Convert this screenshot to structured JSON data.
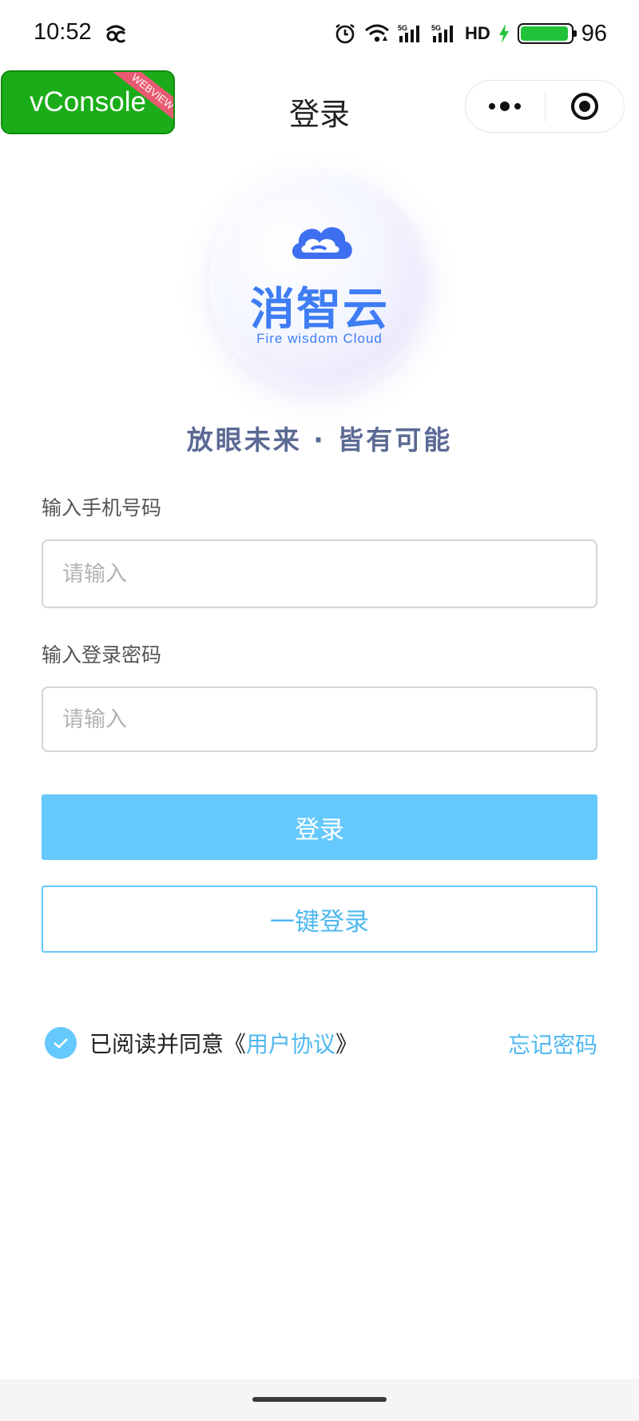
{
  "status_bar": {
    "time": "10:52",
    "left_icon": "app-notification-icon",
    "hd_label": "HD",
    "battery_percent": "96",
    "battery_level": 0.96,
    "icons": [
      "alarm-icon",
      "wifi-icon",
      "signal-5g-icon",
      "signal-5g-icon",
      "charging-icon",
      "battery-icon"
    ]
  },
  "nav": {
    "vconsole_label": "vConsole",
    "vconsole_ribbon": "WEBVIEW",
    "title": "登录",
    "capsule_icons": [
      "more-dots-icon",
      "close-target-icon"
    ]
  },
  "logo": {
    "icon": "cloud-logo-icon",
    "name_cn": "消智云",
    "name_en": "Fire wisdom Cloud"
  },
  "slogan": "放眼未来 · 皆有可能",
  "form": {
    "phone_label": "输入手机号码",
    "phone_placeholder": "请输入",
    "phone_value": "",
    "password_label": "输入登录密码",
    "password_placeholder": "请输入",
    "password_value": ""
  },
  "buttons": {
    "login": "登录",
    "quick_login": "一键登录"
  },
  "agreement": {
    "checked": true,
    "prefix": "已阅读并同意《",
    "link": "用户协议",
    "suffix": "》",
    "forgot": "忘记密码"
  },
  "colors": {
    "primary": "#66c9fd",
    "link": "#4fb8f0",
    "vconsole": "#1aad19",
    "logo": "#3e7df3",
    "slogan": "#5b6a94"
  }
}
